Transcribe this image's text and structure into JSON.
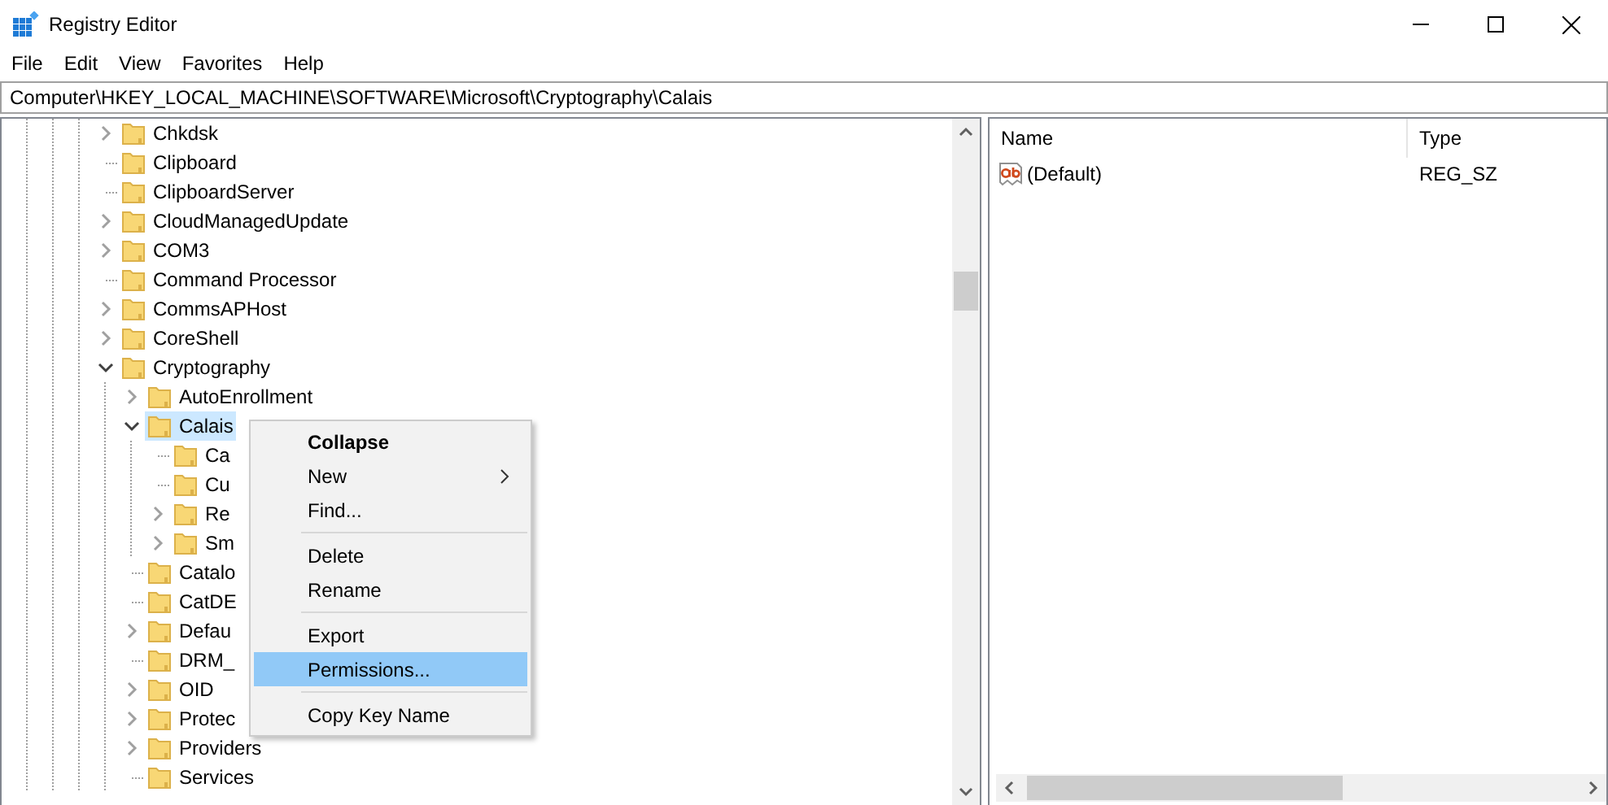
{
  "window": {
    "title": "Registry Editor"
  },
  "menu_bar": [
    "File",
    "Edit",
    "View",
    "Favorites",
    "Help"
  ],
  "address": {
    "value": "Computer\\HKEY_LOCAL_MACHINE\\SOFTWARE\\Microsoft\\Cryptography\\Calais"
  },
  "tree": [
    {
      "name": "Chkdsk",
      "kind": "branch",
      "expanded": false,
      "selected": false
    },
    {
      "name": "Clipboard",
      "kind": "leaf",
      "selected": false
    },
    {
      "name": "ClipboardServer",
      "kind": "leaf",
      "selected": false
    },
    {
      "name": "CloudManagedUpdate",
      "kind": "branch",
      "expanded": false,
      "selected": false
    },
    {
      "name": "COM3",
      "kind": "branch",
      "expanded": false,
      "selected": false
    },
    {
      "name": "Command Processor",
      "kind": "leaf",
      "selected": false
    },
    {
      "name": "CommsAPHost",
      "kind": "branch",
      "expanded": false,
      "selected": false
    },
    {
      "name": "CoreShell",
      "kind": "branch",
      "expanded": false,
      "selected": false
    },
    {
      "name": "Cryptography",
      "kind": "branch",
      "expanded": true,
      "selected": false,
      "children": [
        {
          "name": "AutoEnrollment",
          "kind": "branch",
          "expanded": false,
          "selected": false
        },
        {
          "name": "Calais",
          "kind": "branch",
          "expanded": true,
          "selected": true,
          "children": [
            {
              "name": "Ca",
              "kind": "leaf",
              "selected": false
            },
            {
              "name": "Cu",
              "kind": "leaf",
              "selected": false
            },
            {
              "name": "Re",
              "kind": "branch",
              "expanded": false,
              "selected": false
            },
            {
              "name": "Sm",
              "kind": "branch",
              "expanded": false,
              "selected": false
            }
          ]
        },
        {
          "name": "Catalo",
          "kind": "leaf",
          "selected": false
        },
        {
          "name": "CatDE",
          "kind": "leaf",
          "selected": false
        },
        {
          "name": "Defau",
          "kind": "branch",
          "expanded": false,
          "selected": false
        },
        {
          "name": "DRM_",
          "kind": "leaf",
          "selected": false
        },
        {
          "name": "OID",
          "kind": "branch",
          "expanded": false,
          "selected": false
        },
        {
          "name": "Protec",
          "kind": "branch",
          "expanded": false,
          "selected": false
        },
        {
          "name": "Providers",
          "kind": "branch",
          "expanded": false,
          "selected": false
        },
        {
          "name": "Services",
          "kind": "leaf",
          "selected": false
        }
      ]
    }
  ],
  "values": {
    "columns": [
      "Name",
      "Type"
    ],
    "rows": [
      {
        "name": "(Default)",
        "type": "REG_SZ"
      }
    ]
  },
  "context_menu": [
    {
      "kind": "item",
      "label": "Collapse",
      "default": true,
      "submenu": false,
      "selected": false
    },
    {
      "kind": "item",
      "label": "New",
      "default": false,
      "submenu": true,
      "selected": false
    },
    {
      "kind": "item",
      "label": "Find...",
      "default": false,
      "submenu": false,
      "selected": false
    },
    {
      "kind": "separator"
    },
    {
      "kind": "item",
      "label": "Delete",
      "default": false,
      "submenu": false,
      "selected": false
    },
    {
      "kind": "item",
      "label": "Rename",
      "default": false,
      "submenu": false,
      "selected": false
    },
    {
      "kind": "separator"
    },
    {
      "kind": "item",
      "label": "Export",
      "default": false,
      "submenu": false,
      "selected": false
    },
    {
      "kind": "item",
      "label": "Permissions...",
      "default": false,
      "submenu": false,
      "selected": true
    },
    {
      "kind": "separator"
    },
    {
      "kind": "item",
      "label": "Copy Key Name",
      "default": false,
      "submenu": false,
      "selected": false
    }
  ]
}
